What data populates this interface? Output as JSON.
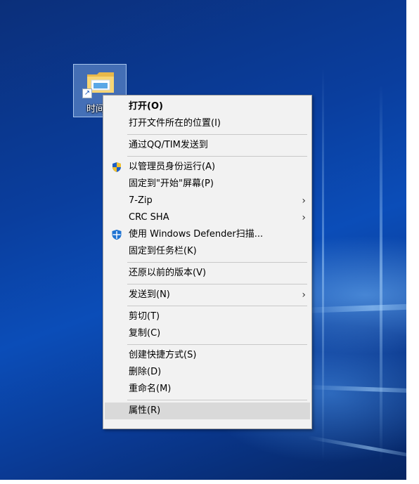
{
  "desktop": {
    "icon_label": "时间",
    "icon_name": "folder-shortcut-icon",
    "shortcut_arrow": "↗"
  },
  "context_menu": {
    "items": [
      {
        "label": "打开(O)",
        "bold": true
      },
      {
        "label": "打开文件所在的位置(I)"
      },
      {
        "separator": true
      },
      {
        "label": "通过QQ/TIM发送到"
      },
      {
        "separator": true
      },
      {
        "label": "以管理员身份运行(A)",
        "icon": "uac-shield-icon"
      },
      {
        "label": "固定到\"开始\"屏幕(P)"
      },
      {
        "label": "7-Zip",
        "submenu": true
      },
      {
        "label": "CRC SHA",
        "submenu": true
      },
      {
        "label": "使用 Windows Defender扫描...",
        "icon": "windows-defender-icon"
      },
      {
        "label": "固定到任务栏(K)"
      },
      {
        "separator": true
      },
      {
        "label": "还原以前的版本(V)"
      },
      {
        "separator": true
      },
      {
        "label": "发送到(N)",
        "submenu": true
      },
      {
        "separator": true
      },
      {
        "label": "剪切(T)"
      },
      {
        "label": "复制(C)"
      },
      {
        "separator": true
      },
      {
        "label": "创建快捷方式(S)"
      },
      {
        "label": "删除(D)"
      },
      {
        "label": "重命名(M)"
      },
      {
        "separator": true
      },
      {
        "label": "属性(R)",
        "highlighted": true
      }
    ],
    "submenu_arrow": "›"
  },
  "colors": {
    "menu_background": "#f2f2f2",
    "menu_highlight": "#d9d9d9",
    "desktop_blue": "#0a3e9e",
    "defender_blue": "#1e73d2"
  }
}
